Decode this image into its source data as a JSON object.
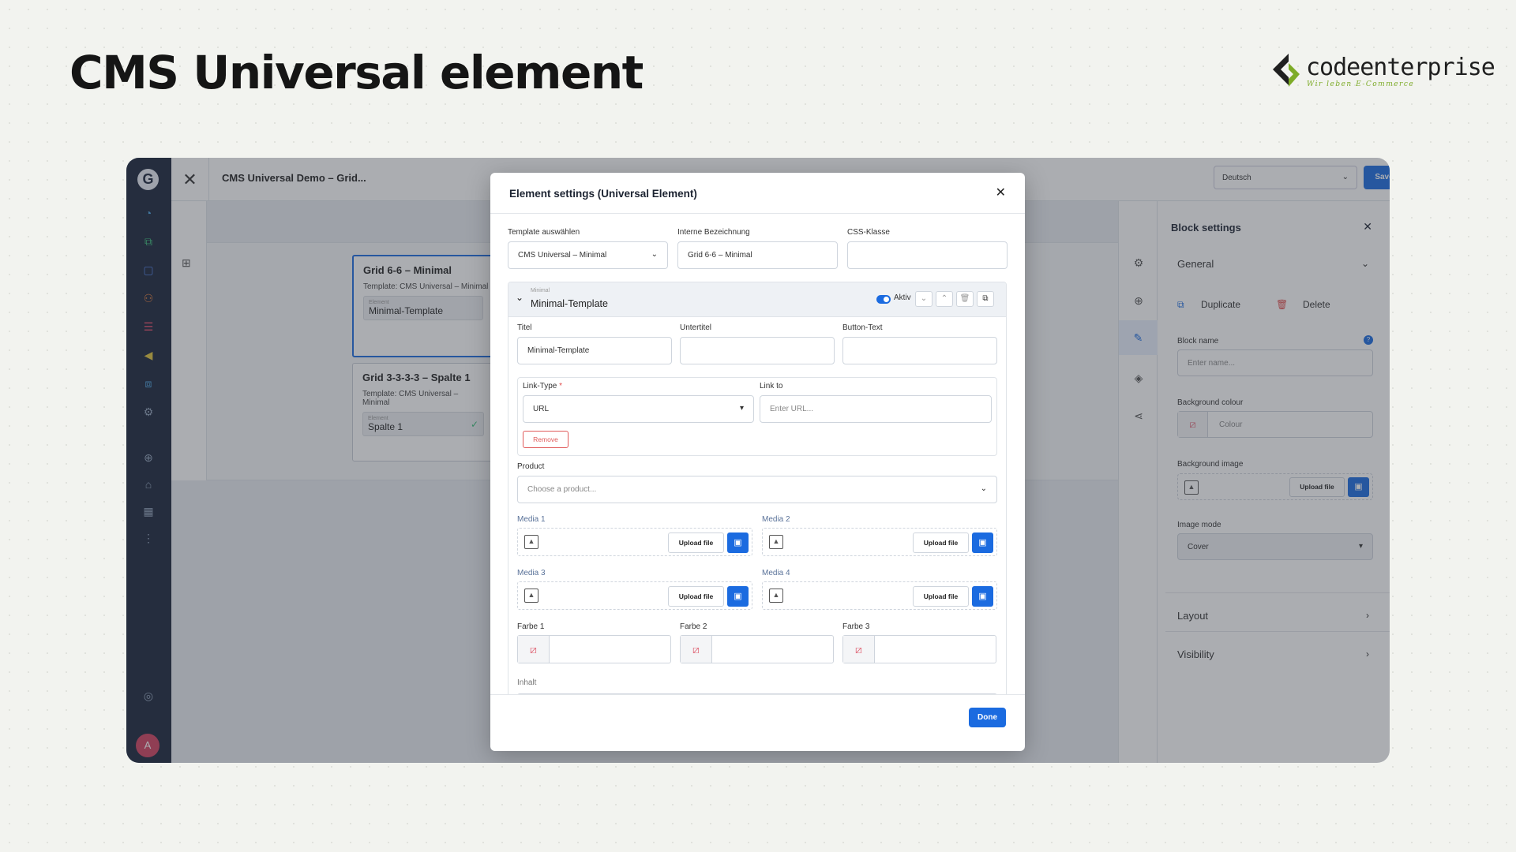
{
  "slide": {
    "heading": "CMS Universal element",
    "logo": {
      "name": "codeenterprise",
      "tagline": "Wir leben E-Commerce",
      "brand_color": "#7dab27"
    }
  },
  "app": {
    "title": "CMS Universal Demo – Grid...",
    "language": "Deutsch",
    "save_label": "Save",
    "avatar_initial": "A",
    "accent": "#1b6be0",
    "sidebar_icons": [
      "dashboard-icon",
      "catalogue-icon",
      "orders-icon",
      "customers-icon",
      "content-icon",
      "marketing-icon",
      "extensions-icon",
      "settings-icon",
      "add-icon",
      "shop-icon",
      "calculator-icon",
      "more-icon",
      "help-icon"
    ]
  },
  "canvas": {
    "cards": [
      {
        "title": "Grid 6-6 – Minimal",
        "template": "Template: CMS Universal – Minimal",
        "field_label": "Element",
        "field_value": "Minimal-Template"
      },
      {
        "title": "Grid 3-3-3-3 – Spalte 1",
        "template": "Template: CMS Universal – Minimal",
        "field_label": "Element",
        "field_value": "Spalte 1"
      }
    ]
  },
  "block_settings": {
    "title": "Block settings",
    "general": "General",
    "duplicate": "Duplicate",
    "delete": "Delete",
    "block_name_label": "Block name",
    "block_name_placeholder": "Enter name...",
    "bg_colour_label": "Background colour",
    "bg_colour_placeholder": "Colour",
    "bg_image_label": "Background image",
    "upload_label": "Upload file",
    "image_mode_label": "Image mode",
    "image_mode_value": "Cover",
    "layout": "Layout",
    "visibility": "Visibility"
  },
  "modal": {
    "title": "Element settings (Universal Element)",
    "template_label": "Template auswählen",
    "template_value": "CMS Universal – Minimal",
    "internal_label": "Interne Bezeichnung",
    "internal_value": "Grid 6-6 – Minimal",
    "css_label": "CSS-Klasse",
    "css_value": "",
    "tpl_small": "Minimal",
    "tpl_name": "Minimal-Template",
    "aktiv": "Aktiv",
    "titel_label": "Titel",
    "titel_value": "Minimal-Template",
    "untertitel_label": "Untertitel",
    "button_label": "Button-Text",
    "link_type_label": "Link-Type",
    "required": "*",
    "link_type_value": "URL",
    "link_to_label": "Link to",
    "link_to_placeholder": "Enter URL...",
    "remove": "Remove",
    "product_label": "Product",
    "product_placeholder": "Choose a product...",
    "media": [
      "Media 1",
      "Media 2",
      "Media 3",
      "Media 4"
    ],
    "upload": "Upload file",
    "farbe": [
      "Farbe 1",
      "Farbe 2",
      "Farbe 3"
    ],
    "inhalt_label": "Inhalt",
    "done": "Done"
  }
}
